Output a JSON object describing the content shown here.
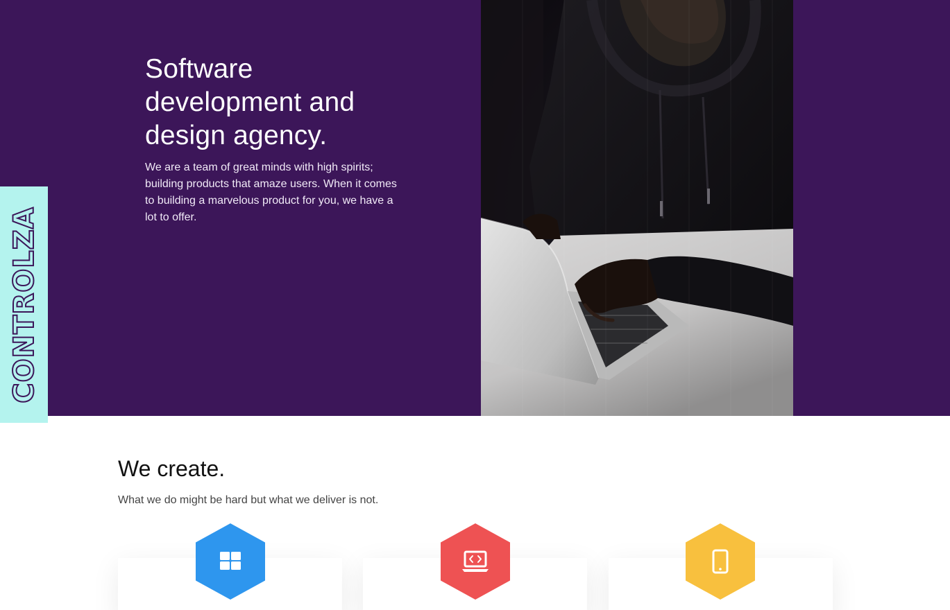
{
  "hero": {
    "title": "Software development and design agency.",
    "description": "We are a team of great minds with high spirits; building products that amaze users. When it comes to building a marvelous product for you, we have a lot to offer.",
    "background_color": "#3c1659"
  },
  "brand": {
    "name": "CONTROLZA",
    "tab_color": "#b4f3ee"
  },
  "services": {
    "title": "We create.",
    "subtitle": "What we do might be hard but what we deliver is not.",
    "cards": [
      {
        "icon": "windows-grid-icon",
        "color": "#2e96ee"
      },
      {
        "icon": "laptop-code-icon",
        "color": "#ee5253"
      },
      {
        "icon": "smartphone-icon",
        "color": "#f8c03e"
      }
    ]
  }
}
